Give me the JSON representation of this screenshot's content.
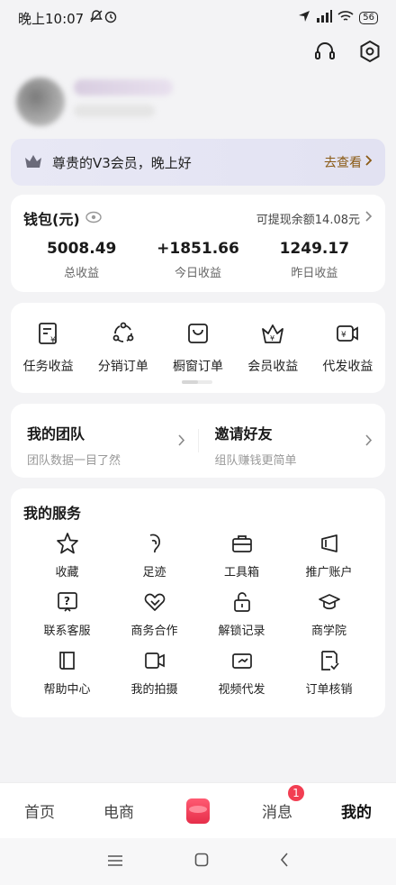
{
  "status": {
    "time": "晚上10:07",
    "battery": "56"
  },
  "vip": {
    "text": "尊贵的V3会员，晚上好",
    "link": "去查看"
  },
  "wallet": {
    "title": "钱包(元)",
    "withdraw": "可提现余额14.08元",
    "stats": [
      {
        "value": "5008.49",
        "label": "总收益"
      },
      {
        "value": "+1851.66",
        "label": "今日收益"
      },
      {
        "value": "1249.17",
        "label": "昨日收益"
      }
    ]
  },
  "income": [
    {
      "label": "任务收益",
      "icon": "task-income-icon"
    },
    {
      "label": "分销订单",
      "icon": "distribution-icon"
    },
    {
      "label": "橱窗订单",
      "icon": "bag-icon"
    },
    {
      "label": "会员收益",
      "icon": "crown-icon"
    },
    {
      "label": "代发收益",
      "icon": "video-income-icon"
    }
  ],
  "team": {
    "my_team": {
      "title": "我的团队",
      "sub": "团队数据一目了然"
    },
    "invite": {
      "title": "邀请好友",
      "sub": "组队赚钱更简单"
    }
  },
  "services": {
    "title": "我的服务",
    "items": [
      {
        "label": "收藏",
        "icon": "star-icon"
      },
      {
        "label": "足迹",
        "icon": "footprint-icon"
      },
      {
        "label": "工具箱",
        "icon": "toolbox-icon"
      },
      {
        "label": "推广账户",
        "icon": "megaphone-icon"
      },
      {
        "label": "联系客服",
        "icon": "help-chat-icon"
      },
      {
        "label": "商务合作",
        "icon": "handshake-icon"
      },
      {
        "label": "解锁记录",
        "icon": "unlock-icon"
      },
      {
        "label": "商学院",
        "icon": "graduation-cap-icon"
      },
      {
        "label": "帮助中心",
        "icon": "book-icon"
      },
      {
        "label": "我的拍摄",
        "icon": "camera-icon"
      },
      {
        "label": "视频代发",
        "icon": "video-icon"
      },
      {
        "label": "订单核销",
        "icon": "order-check-icon"
      }
    ]
  },
  "tabs": [
    {
      "label": "首页"
    },
    {
      "label": "电商"
    },
    {
      "label": ""
    },
    {
      "label": "消息",
      "badge": "1"
    },
    {
      "label": "我的"
    }
  ]
}
